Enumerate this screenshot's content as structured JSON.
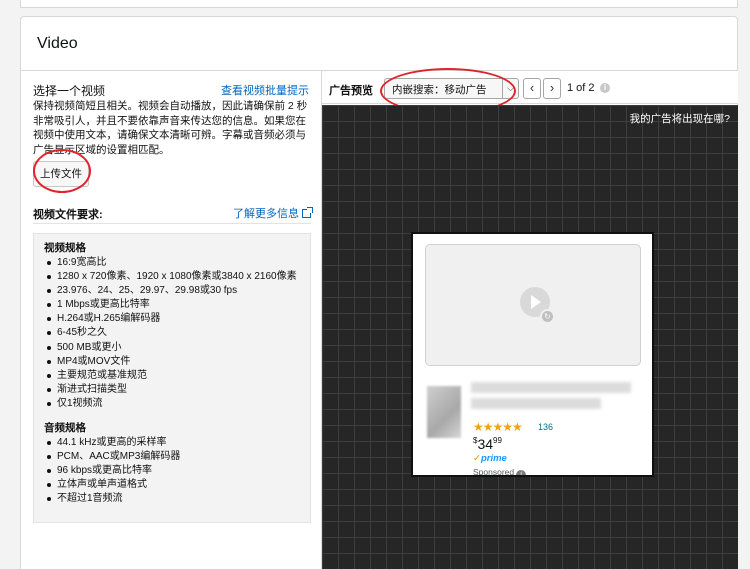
{
  "panel": {
    "title": "Video"
  },
  "left": {
    "title": "选择一个视频",
    "batch_tips_link": "查看视频批量提示",
    "description": "保持视频简短且相关。视频会自动播放，因此请确保前 2 秒非常吸引人，并且不要依靠声音来传达您的信息。如果您在视频中使用文本，请确保文本清晰可辨。字幕或音频必须与广告显示区域的设置相匹配。",
    "upload_button": "上传文件",
    "requirements": {
      "title": "视频文件要求:",
      "learn_more_link": "了解更多信息",
      "video_section": "视频规格",
      "video_items": [
        "16:9宽高比",
        "1280 x 720像素、1920 x 1080像素或3840 x 2160像素",
        "23.976、24、25、29.97、29.98或30 fps",
        "1 Mbps或更高比特率",
        "H.264或H.265编解码器",
        "6-45秒之久",
        "500 MB或更小",
        "MP4或MOV文件",
        "主要规范或基准规范",
        "渐进式扫描类型",
        "仅1视频流"
      ],
      "audio_section": "音频规格",
      "audio_items": [
        "44.1 kHz或更高的采样率",
        "PCM、AAC或MP3编解码器",
        "96 kbps或更高比特率",
        "立体声或单声道格式",
        "不超过1音频流"
      ]
    }
  },
  "preview": {
    "label": "广告预览",
    "placement_select": "内嵌搜索：移动广告",
    "pagination": "1 of 2",
    "canvas_question": "我的广告将出现在哪?",
    "ad": {
      "rating_count": "136",
      "price_currency": "$",
      "price_whole": "34",
      "price_fraction": "99",
      "prime_label": "prime",
      "sponsored_label": "Sponsored",
      "rating_stars": 4.5
    }
  },
  "colors": {
    "link": "#0066c0",
    "annotation_circle": "#e0242b",
    "star": "#f0a30a",
    "prime": "#1a98ff"
  }
}
